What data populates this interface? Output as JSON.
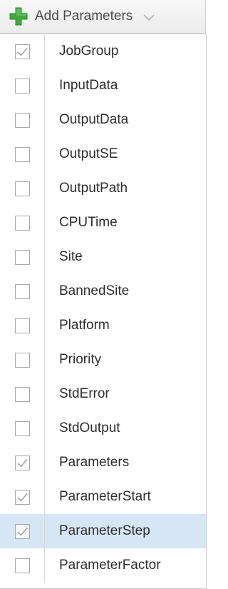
{
  "toolbar": {
    "label": "Add Parameters",
    "icon": "plus-icon",
    "dropdown_icon": "chevron-down-icon",
    "icon_color": "#3cab3c"
  },
  "menu": {
    "highlight_color": "#d6e6f4",
    "items": [
      {
        "label": "JobGroup",
        "checked": true,
        "highlighted": false
      },
      {
        "label": "InputData",
        "checked": false,
        "highlighted": false
      },
      {
        "label": "OutputData",
        "checked": false,
        "highlighted": false
      },
      {
        "label": "OutputSE",
        "checked": false,
        "highlighted": false
      },
      {
        "label": "OutputPath",
        "checked": false,
        "highlighted": false
      },
      {
        "label": "CPUTime",
        "checked": false,
        "highlighted": false
      },
      {
        "label": "Site",
        "checked": false,
        "highlighted": false
      },
      {
        "label": "BannedSite",
        "checked": false,
        "highlighted": false
      },
      {
        "label": "Platform",
        "checked": false,
        "highlighted": false
      },
      {
        "label": "Priority",
        "checked": false,
        "highlighted": false
      },
      {
        "label": "StdError",
        "checked": false,
        "highlighted": false
      },
      {
        "label": "StdOutput",
        "checked": false,
        "highlighted": false
      },
      {
        "label": "Parameters",
        "checked": true,
        "highlighted": false
      },
      {
        "label": "ParameterStart",
        "checked": true,
        "highlighted": false
      },
      {
        "label": "ParameterStep",
        "checked": true,
        "highlighted": true
      },
      {
        "label": "ParameterFactor",
        "checked": false,
        "highlighted": false
      }
    ]
  }
}
